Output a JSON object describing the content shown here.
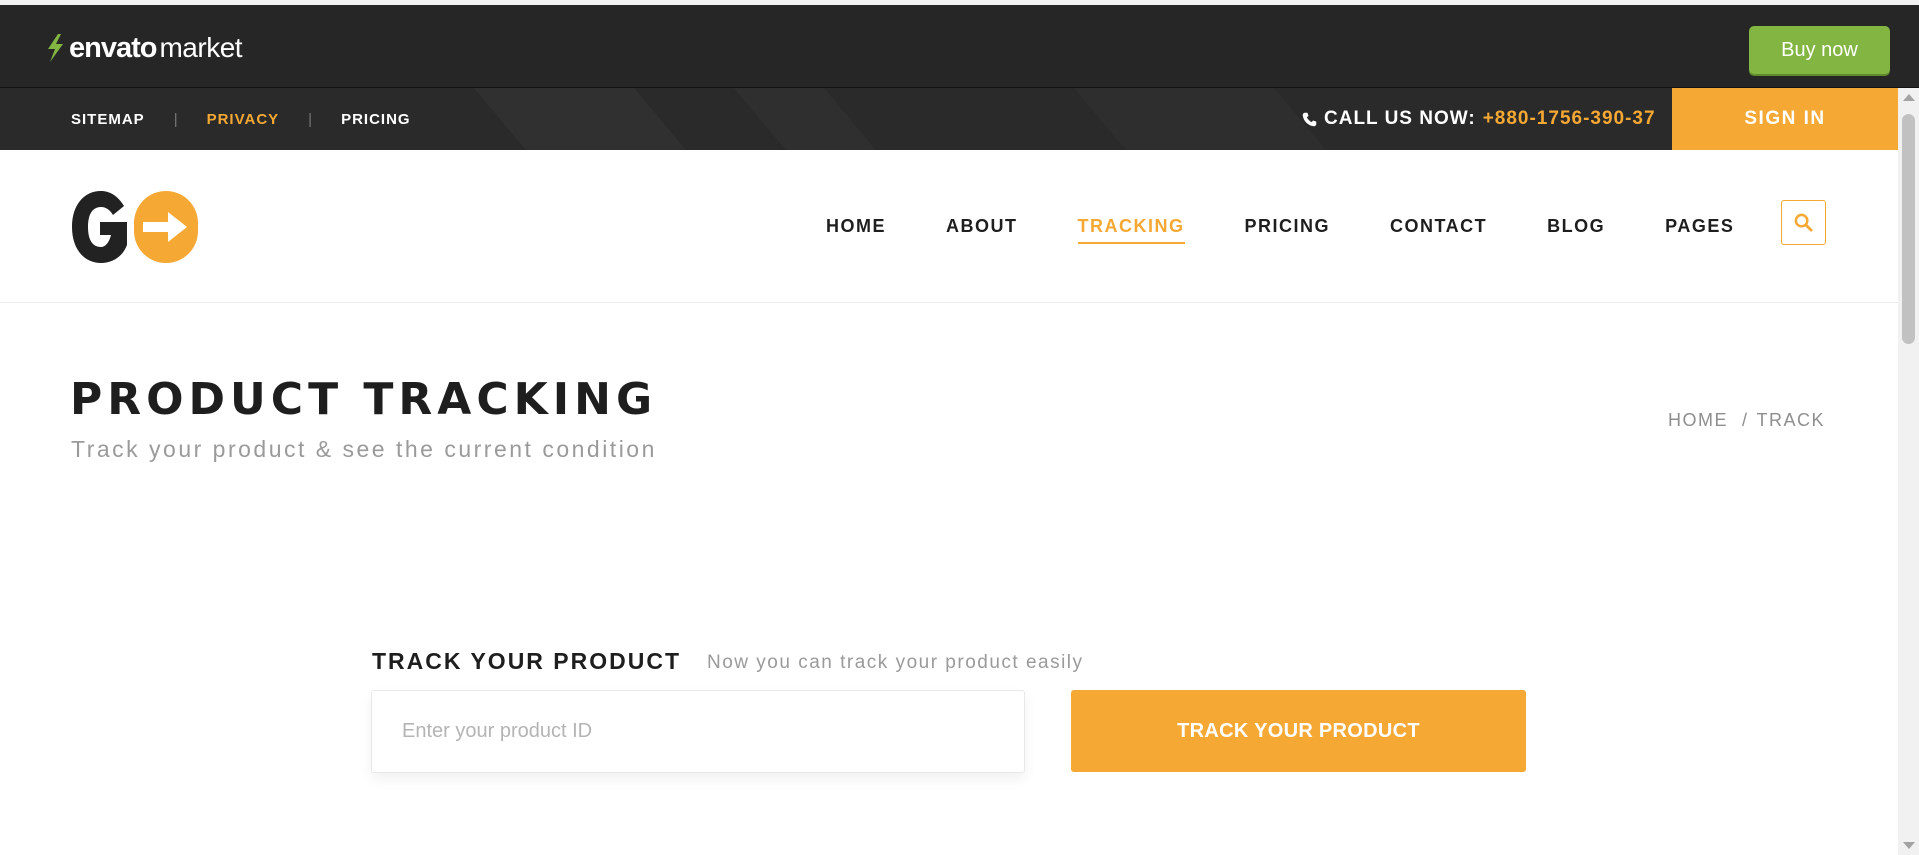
{
  "envato": {
    "brand": "envato",
    "market": "market",
    "buy_now": "Buy now",
    "brand_color": "#82b541"
  },
  "topbar": {
    "links": [
      {
        "label": "SITEMAP"
      },
      {
        "label": "PRIVACY"
      },
      {
        "label": "PRICING"
      }
    ],
    "call_label": "CALL US NOW:",
    "phone": "+880-1756-390-37",
    "sign_in": "SIGN IN",
    "accent_color": "#f5a833"
  },
  "nav": {
    "items": [
      {
        "label": "HOME"
      },
      {
        "label": "ABOUT"
      },
      {
        "label": "TRACKING"
      },
      {
        "label": "PRICING"
      },
      {
        "label": "CONTACT"
      },
      {
        "label": "BLOG"
      },
      {
        "label": "PAGES"
      }
    ],
    "active": "TRACKING"
  },
  "page": {
    "title": "PRODUCT TRACKING",
    "subtitle": "Track your product & see the current condition",
    "breadcrumb": [
      "HOME",
      "TRACK"
    ]
  },
  "tracking": {
    "heading": "TRACK YOUR PRODUCT",
    "note": "Now you can track your product easily",
    "input_placeholder": "Enter your product ID",
    "button_label": "TRACK YOUR PRODUCT"
  }
}
